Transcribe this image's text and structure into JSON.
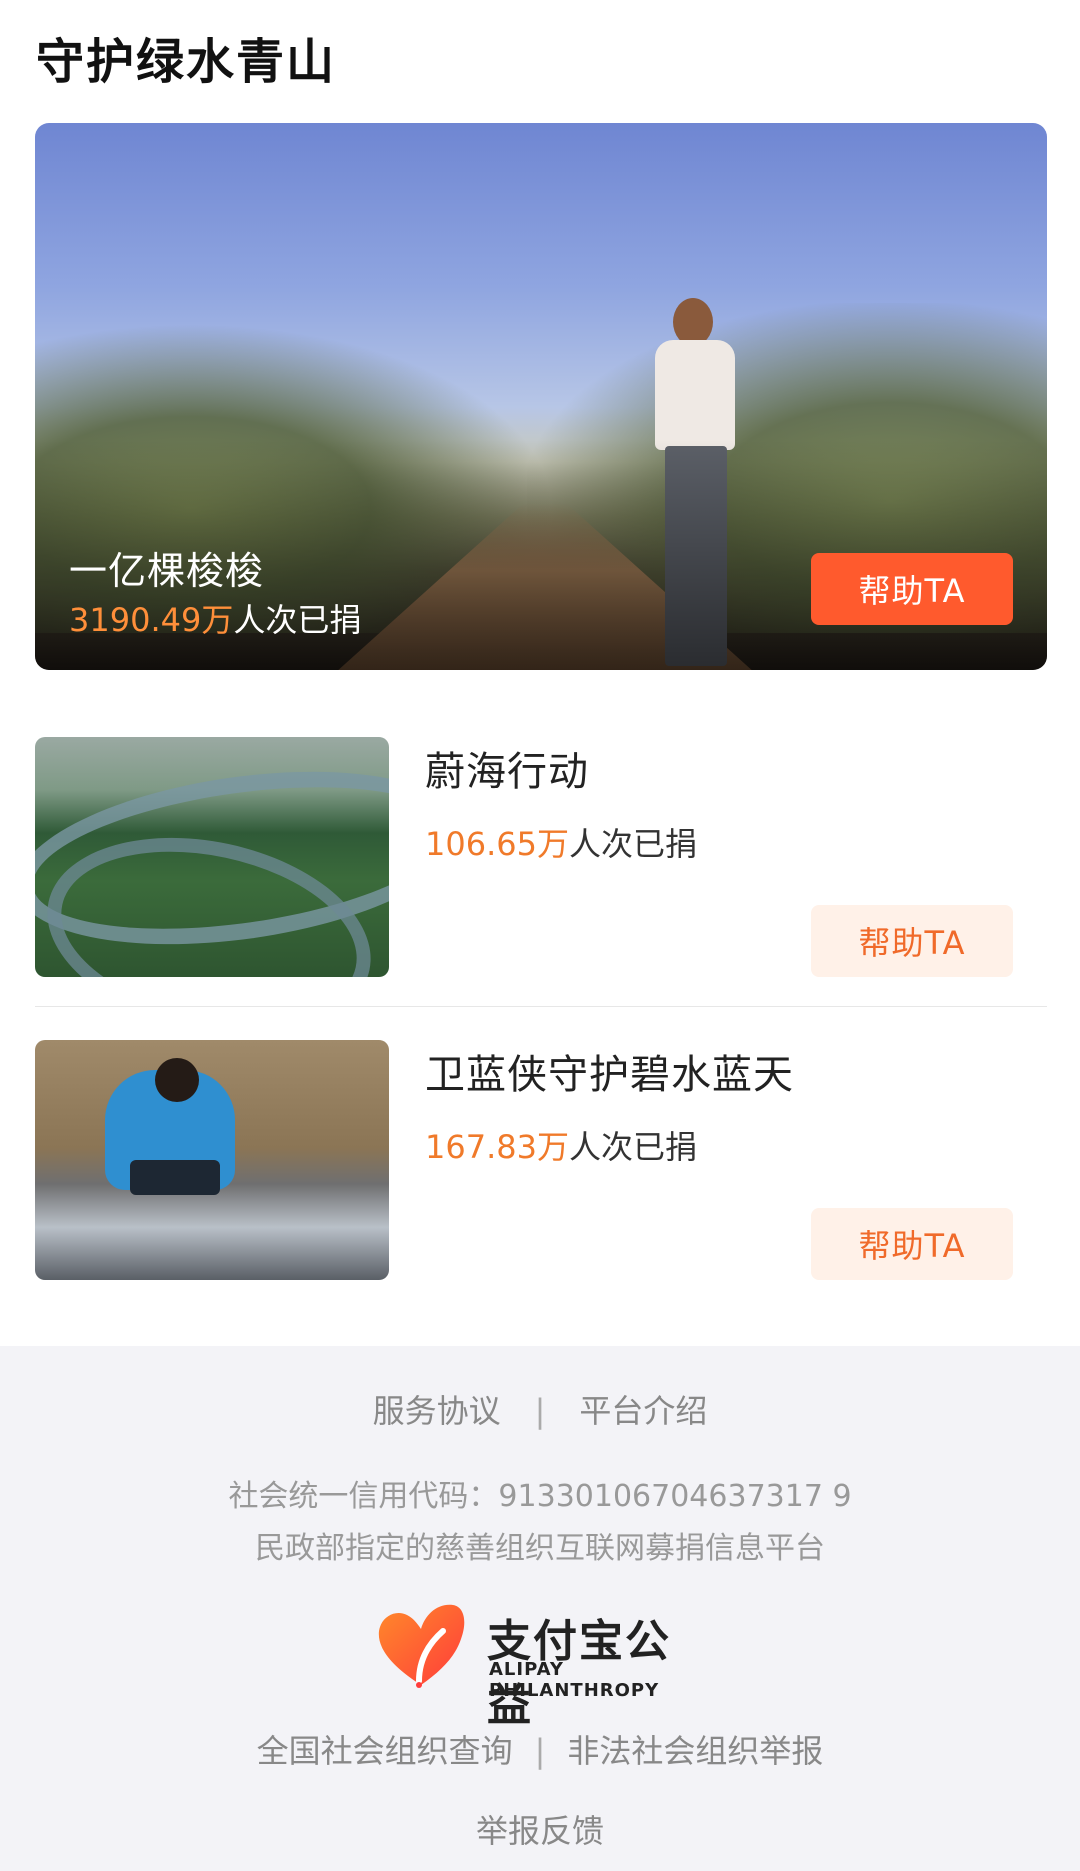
{
  "section": {
    "title": "守护绿水青山"
  },
  "featured": {
    "name": "一亿棵梭梭",
    "count": "3190.49万",
    "count_suffix": "人次已捐",
    "button": "帮助TA"
  },
  "projects": [
    {
      "name": "蔚海行动",
      "count": "106.65万",
      "count_suffix": "人次已捐",
      "button": "帮助TA"
    },
    {
      "name": "卫蓝侠守护碧水蓝天",
      "count": "167.83万",
      "count_suffix": "人次已捐",
      "button": "帮助TA"
    }
  ],
  "footer": {
    "links": [
      "服务协议",
      "平台介绍"
    ],
    "separator": "|",
    "credit_code": "社会统一信用代码：91330106704637317 9",
    "credit_line": "民政部指定的慈善组织互联网募捐信息平台",
    "logo_cn": "支付宝公益",
    "logo_en": "ALIPAY PHILANTHROPY",
    "links2": [
      "全国社会组织查询",
      "非法社会组织举报"
    ],
    "report": "举报反馈"
  },
  "colors": {
    "accent": "#ff5a2d",
    "count": "#f07a2a",
    "button_light_bg": "#fff1e8"
  }
}
